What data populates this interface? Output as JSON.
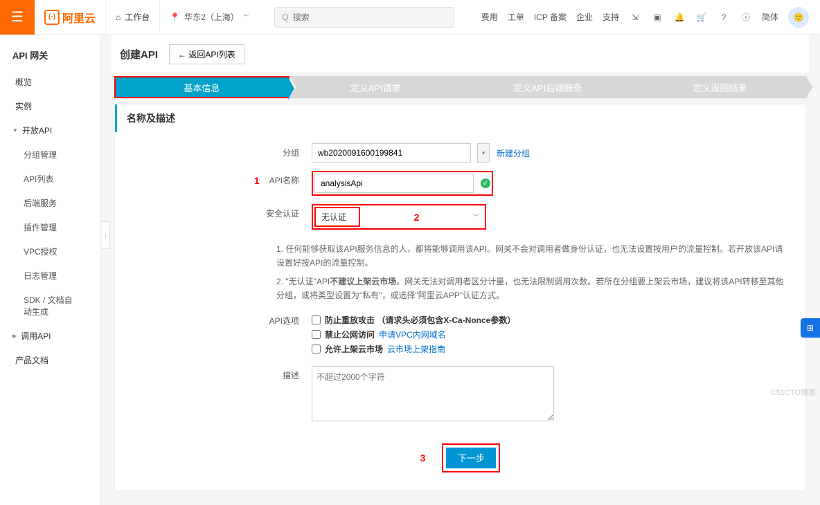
{
  "topbar": {
    "brand": "阿里云",
    "workbench": "工作台",
    "region": "华东2（上海）",
    "search_placeholder": "搜索",
    "links": {
      "fee": "费用",
      "order": "工单",
      "icp": "ICP 备案",
      "enterprise": "企业",
      "support": "支持",
      "lang": "简体"
    }
  },
  "sidebar": {
    "title": "API 网关",
    "items": {
      "overview": "概览",
      "instance": "实例",
      "open_api": "开放API",
      "group": "分组管理",
      "api_list": "API列表",
      "backend": "后端服务",
      "plugin": "插件管理",
      "vpc": "VPC授权",
      "log": "日志管理",
      "sdk": "SDK / 文档自动生成",
      "call_api": "调用API",
      "docs": "产品文档"
    }
  },
  "page": {
    "title": "创建API",
    "back": "← 返回API列表"
  },
  "steps": [
    "基本信息",
    "定义API请求",
    "定义API后端服务",
    "定义返回结果"
  ],
  "card": {
    "title": "名称及描述"
  },
  "form": {
    "group_label": "分组",
    "group_value": "wb2020091600199841",
    "new_group": "新建分组",
    "name_label": "API名称",
    "name_value": "analysisApi",
    "auth_label": "安全认证",
    "auth_value": "无认证",
    "note1": "1. 任何能够获取该API服务信息的人，都将能够调用该API。网关不会对调用者做身份认证，也无法设置按用户的流量控制。若开放该API请设置好按API的流量控制。",
    "note2a": "2. \"无认证\"API",
    "note2b": "不建议上架云市场",
    "note2c": "。网关无法对调用者区分计量，也无法限制调用次数。若所在分组要上架云市场，建议将该API转移至其他分组，或将类型设置为\"私有\"，或选择\"阿里云APP\"认证方式。",
    "options_label": "API选项",
    "opt1": "防止重放攻击 （请求头必须包含X-Ca-Nonce参数）",
    "opt2": "禁止公网访问",
    "opt2_link": "申请VPC内网域名",
    "opt3": "允许上架云市场",
    "opt3_link": "云市场上架指南",
    "desc_label": "描述",
    "desc_placeholder": "不超过2000个字符",
    "next": "下一步"
  },
  "annotations": {
    "a1": "1",
    "a2": "2",
    "a3": "3"
  },
  "watermark": "©51CTO博客"
}
